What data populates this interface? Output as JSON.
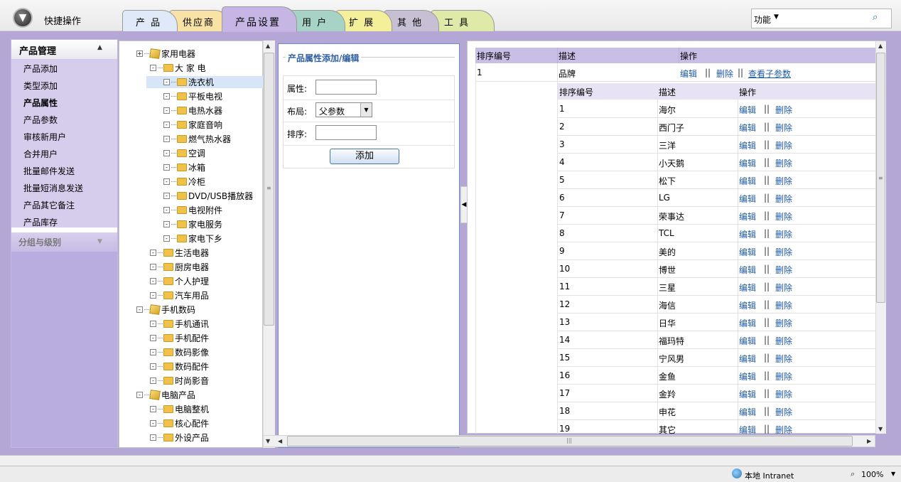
{
  "header": {
    "quick_label": "快捷操作",
    "tabs": [
      {
        "label": "产 品",
        "color": "#dfe9f7"
      },
      {
        "label": "供应商",
        "color": "#f9e2a6"
      },
      {
        "label": "产品设置",
        "color": "#c5b6e6",
        "active": true
      },
      {
        "label": "用 户",
        "color": "#a7d3c6"
      },
      {
        "label": "扩 展",
        "color": "#f4f09a"
      },
      {
        "label": "其 他",
        "color": "#c7c0d4"
      },
      {
        "label": "工 具",
        "color": "#dfe9a8"
      }
    ],
    "function_label": "功能",
    "function_arrow": "▼",
    "search_icon": "search-icon"
  },
  "sidebar": {
    "section1_title": "产品管理",
    "section1_arrow": "▲",
    "items": [
      {
        "label": "产品添加",
        "active": false
      },
      {
        "label": "类型添加",
        "active": false
      },
      {
        "label": "产品属性",
        "active": true
      },
      {
        "label": "产品参数",
        "active": false
      },
      {
        "label": "审核新用户",
        "active": false
      },
      {
        "label": "合并用户",
        "active": false
      },
      {
        "label": "批量邮件发送",
        "active": false
      },
      {
        "label": "批量短消息发送",
        "active": false
      },
      {
        "label": "产品其它备注",
        "active": false
      },
      {
        "label": "产品库存",
        "active": false
      }
    ],
    "section2_title": "分组与级别",
    "section2_arrow": "▼"
  },
  "tree": [
    {
      "label": "家用电器",
      "level": 0,
      "icon": "box",
      "toggle": "+"
    },
    {
      "label": "大 家 电",
      "level": 1,
      "icon": "folder",
      "toggle": "-"
    },
    {
      "label": "洗衣机",
      "level": 2,
      "icon": "folder",
      "toggle": "-",
      "selected": true
    },
    {
      "label": "平板电视",
      "level": 2,
      "icon": "folder",
      "toggle": "-"
    },
    {
      "label": "电热水器",
      "level": 2,
      "icon": "folder",
      "toggle": "-"
    },
    {
      "label": "家庭音响",
      "level": 2,
      "icon": "folder",
      "toggle": "-"
    },
    {
      "label": "燃气热水器",
      "level": 2,
      "icon": "folder",
      "toggle": "-"
    },
    {
      "label": "空调",
      "level": 2,
      "icon": "folder",
      "toggle": "-"
    },
    {
      "label": "冰箱",
      "level": 2,
      "icon": "folder",
      "toggle": "-"
    },
    {
      "label": "冷柜",
      "level": 2,
      "icon": "folder",
      "toggle": "-"
    },
    {
      "label": "DVD/USB播放器",
      "level": 2,
      "icon": "folder",
      "toggle": "-"
    },
    {
      "label": "电视附件",
      "level": 2,
      "icon": "folder",
      "toggle": "-"
    },
    {
      "label": "家电服务",
      "level": 2,
      "icon": "folder",
      "toggle": "-"
    },
    {
      "label": "家电下乡",
      "level": 2,
      "icon": "folder",
      "toggle": "-"
    },
    {
      "label": "生活电器",
      "level": 1,
      "icon": "folder",
      "toggle": "-"
    },
    {
      "label": "厨房电器",
      "level": 1,
      "icon": "folder",
      "toggle": "-"
    },
    {
      "label": "个人护理",
      "level": 1,
      "icon": "folder",
      "toggle": "-"
    },
    {
      "label": "汽车用品",
      "level": 1,
      "icon": "folder",
      "toggle": "-"
    },
    {
      "label": "手机数码",
      "level": 0,
      "icon": "box",
      "toggle": "-"
    },
    {
      "label": "手机通讯",
      "level": 1,
      "icon": "folder",
      "toggle": "-"
    },
    {
      "label": "手机配件",
      "level": 1,
      "icon": "folder",
      "toggle": "-"
    },
    {
      "label": "数码影像",
      "level": 1,
      "icon": "folder",
      "toggle": "-"
    },
    {
      "label": "数码配件",
      "level": 1,
      "icon": "folder",
      "toggle": "-"
    },
    {
      "label": "时尚影音",
      "level": 1,
      "icon": "folder",
      "toggle": "-"
    },
    {
      "label": "电脑产品",
      "level": 0,
      "icon": "box",
      "toggle": "-"
    },
    {
      "label": "电脑整机",
      "level": 1,
      "icon": "folder",
      "toggle": "-"
    },
    {
      "label": "核心配件",
      "level": 1,
      "icon": "folder",
      "toggle": "-"
    },
    {
      "label": "外设产品",
      "level": 1,
      "icon": "folder",
      "toggle": "-"
    }
  ],
  "form": {
    "legend": "产品属性添加/编辑",
    "attribute_label": "属性:",
    "attribute_value": "",
    "layout_label": "布局:",
    "layout_value": "父参数",
    "order_label": "排序:",
    "order_value": "",
    "add_button": "添加"
  },
  "grid": {
    "headers": [
      "排序编号",
      "描述",
      "操作"
    ],
    "top_row": {
      "order": "1",
      "desc": "品牌",
      "edit": "编辑",
      "delete": "删除",
      "view_sub": "查看子参数",
      "sep": "||"
    },
    "sub_headers": [
      "排序编号",
      "描述",
      "操作"
    ],
    "sub_rows": [
      {
        "order": "1",
        "desc": "海尔"
      },
      {
        "order": "2",
        "desc": "西门子"
      },
      {
        "order": "3",
        "desc": "三洋"
      },
      {
        "order": "4",
        "desc": "小天鹅"
      },
      {
        "order": "5",
        "desc": "松下"
      },
      {
        "order": "6",
        "desc": "LG"
      },
      {
        "order": "7",
        "desc": "荣事达"
      },
      {
        "order": "8",
        "desc": "TCL"
      },
      {
        "order": "9",
        "desc": "美的"
      },
      {
        "order": "10",
        "desc": "博世"
      },
      {
        "order": "11",
        "desc": "三星"
      },
      {
        "order": "12",
        "desc": "海信"
      },
      {
        "order": "13",
        "desc": "日华"
      },
      {
        "order": "14",
        "desc": "福玛特"
      },
      {
        "order": "15",
        "desc": "宁风男"
      },
      {
        "order": "16",
        "desc": "金鱼"
      },
      {
        "order": "17",
        "desc": "金羚"
      },
      {
        "order": "18",
        "desc": "申花"
      },
      {
        "order": "19",
        "desc": "其它"
      }
    ],
    "edit_label": "编辑",
    "delete_label": "删除",
    "sep": "||"
  },
  "statusbar": {
    "zone": "本地 Intranet",
    "zoom": "100%"
  }
}
